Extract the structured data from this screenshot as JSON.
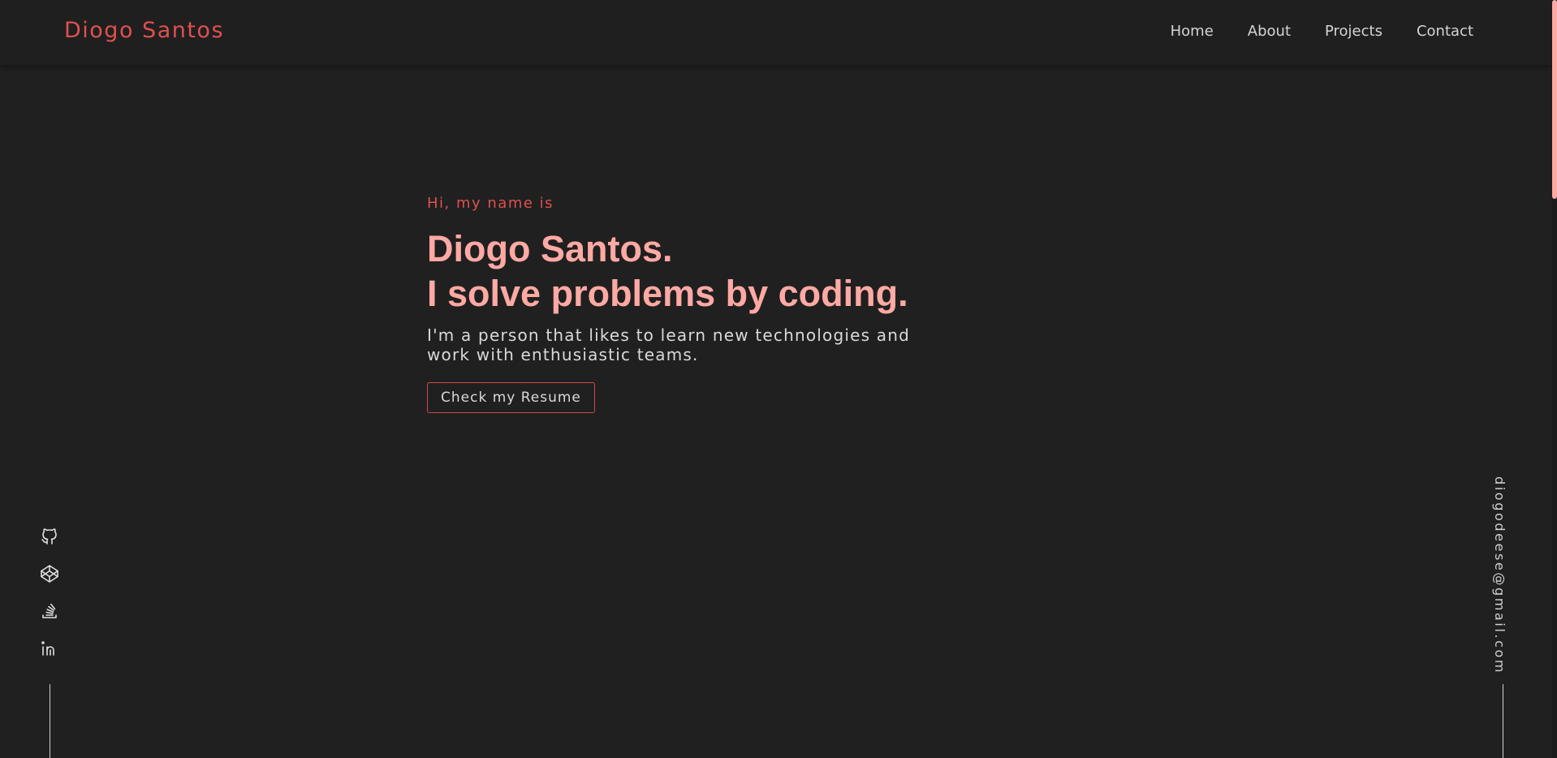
{
  "colors": {
    "background": "#202020",
    "accent": "#e05050",
    "headline": "#ffa9a4",
    "text": "#d9d9d9"
  },
  "header": {
    "logo": "Diogo Santos",
    "nav": [
      "Home",
      "About",
      "Projects",
      "Contact"
    ]
  },
  "hero": {
    "greeting": "Hi, my name is",
    "name_line": "Diogo Santos.",
    "headline_line": "I solve problems by coding.",
    "tagline": "I'm a person that likes to learn new technologies and work with enthusiastic teams.",
    "button_label": "Check my Resume"
  },
  "social": {
    "icons": [
      "github-icon",
      "codepen-icon",
      "stackoverflow-icon",
      "linkedin-icon"
    ]
  },
  "email": "diogodeese@gmail.com"
}
